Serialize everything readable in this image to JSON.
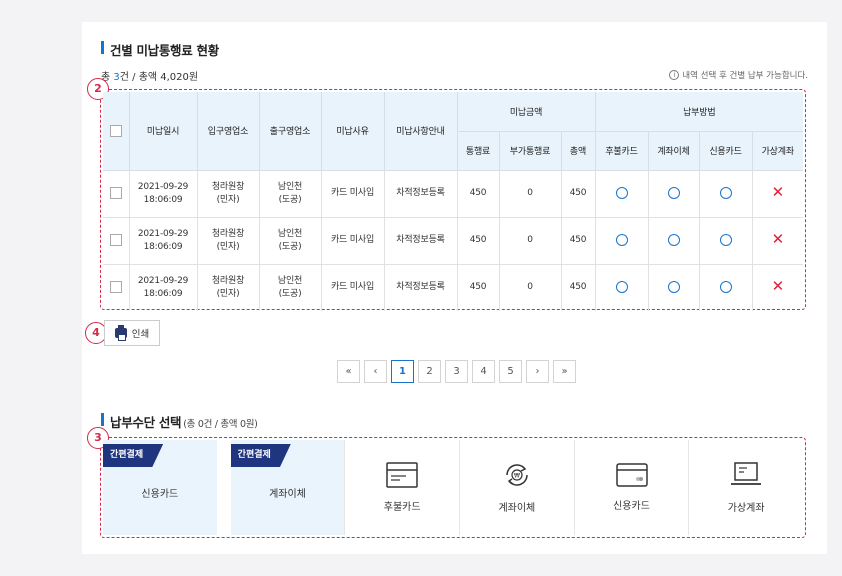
{
  "section1": {
    "title": "건별 미납통행료 현황",
    "summary_prefix": "총 ",
    "summary_count": "3",
    "summary_suffix": "건 / 총액 4,020원",
    "note": "내역 선택 후 건별 납부 가능합니다."
  },
  "badges": {
    "table": "2",
    "methods": "3",
    "print": "4"
  },
  "table": {
    "headers": {
      "date": "미납일시",
      "entry": "입구영업소",
      "exit": "출구영업소",
      "reason": "미납사유",
      "guide": "미납사항안내",
      "amount_group": "미납금액",
      "toll": "통행료",
      "extra": "부가통행료",
      "total": "총액",
      "method_group": "납부방법",
      "postpaid": "후불카드",
      "transfer": "계좌이체",
      "credit": "신용카드",
      "virtual": "가상계좌"
    },
    "rows": [
      {
        "date1": "2021-09-29",
        "date2": "18:06:09",
        "entry1": "청라원창",
        "entry2": "(민자)",
        "exit1": "남인천",
        "exit2": "(도공)",
        "reason": "카드 미사입",
        "guide": "차적정보등록",
        "toll": "450",
        "extra": "0",
        "total": "450"
      },
      {
        "date1": "2021-09-29",
        "date2": "18:06:09",
        "entry1": "청라원창",
        "entry2": "(민자)",
        "exit1": "남인천",
        "exit2": "(도공)",
        "reason": "카드 미사입",
        "guide": "차적정보등록",
        "toll": "450",
        "extra": "0",
        "total": "450"
      },
      {
        "date1": "2021-09-29",
        "date2": "18:06:09",
        "entry1": "청라원창",
        "entry2": "(민자)",
        "exit1": "남인천",
        "exit2": "(도공)",
        "reason": "카드 미사입",
        "guide": "차적정보등록",
        "toll": "450",
        "extra": "0",
        "total": "450"
      }
    ],
    "marks": {
      "available": "○",
      "unavailable": "✕"
    }
  },
  "print_label": "인쇄",
  "pager": {
    "first": "«",
    "prev": "‹",
    "pages": [
      "1",
      "2",
      "3",
      "4",
      "5"
    ],
    "next": "›",
    "last": "»",
    "active": "1"
  },
  "section2": {
    "title": "납부수단 선택",
    "sub": "(총 0건 / 총액 0원)",
    "easy_tag": "간편결제",
    "methods": [
      "신용카드",
      "계좌이체",
      "후불카드",
      "계좌이체",
      "신용카드",
      "가상계좌"
    ]
  },
  "colors": {
    "accent": "#1a73c9",
    "dashed": "#d6284a",
    "tag": "#203580",
    "header_bg": "#e8f3fb",
    "x_mark": "#e0213c"
  }
}
